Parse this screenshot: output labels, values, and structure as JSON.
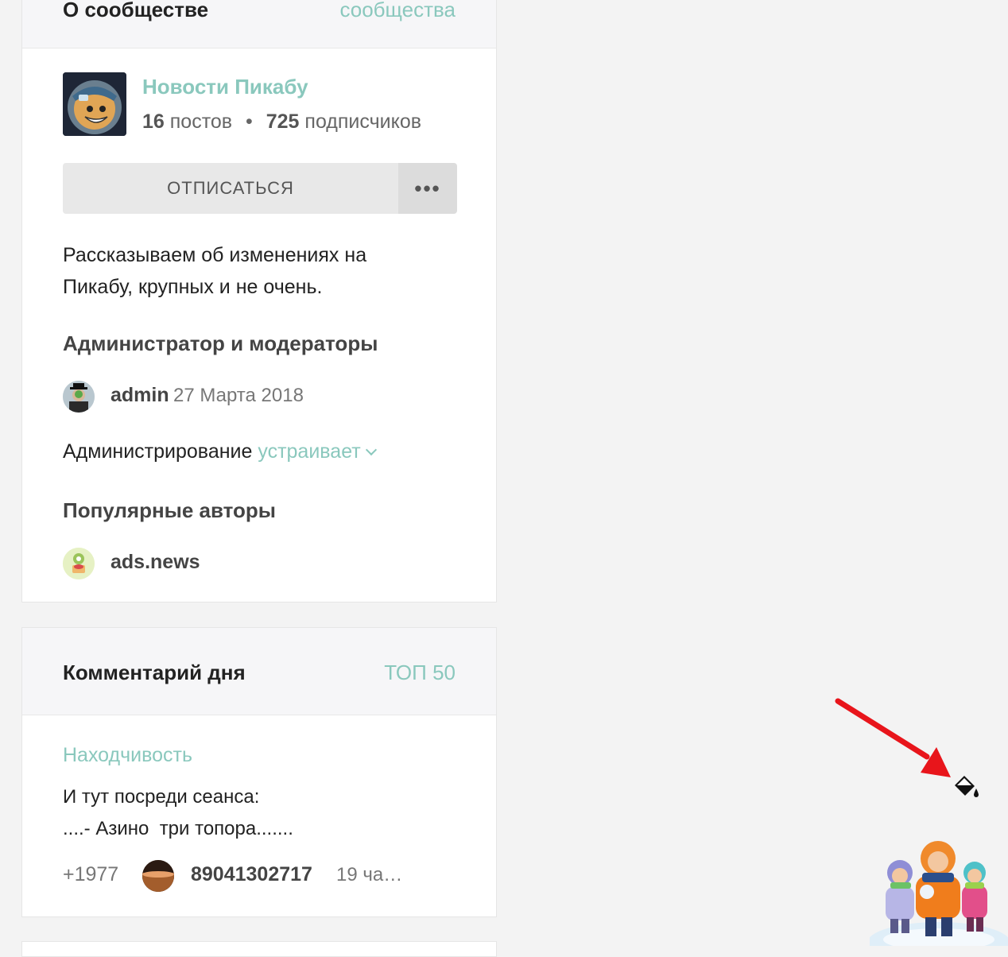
{
  "community": {
    "header_title": "О сообществе",
    "header_link": "сообщества",
    "name": "Новости Пикабу",
    "posts_count": "16",
    "posts_label": "постов",
    "subscribers_count": "725",
    "subscribers_label": "подписчиков",
    "unsubscribe_label": "ОТПИСАТЬСЯ",
    "more_label": "•••",
    "description": "Рассказываем об изменениях на Пикабу, крупных и не очень.",
    "admins_title": "Администратор и модераторы",
    "admin": {
      "name": "admin",
      "date": "27 Марта 2018"
    },
    "admin_status_label": "Администрирование",
    "admin_status_value": "устраивает",
    "popular_title": "Популярные авторы",
    "popular_author": "ads.news"
  },
  "comment_of_day": {
    "header_title": "Комментарий дня",
    "header_link": "ТОП 50",
    "post_title": "Находчивость",
    "text": "И тут посреди сеанса:\n....- Азино  три топора.......",
    "rating": "+1977",
    "user": "89041302717",
    "time": "19 ча…"
  },
  "accent_color": "#8ac8bd",
  "icons": [
    "paint-bucket-icon",
    "red-arrow",
    "winter-mascot"
  ]
}
